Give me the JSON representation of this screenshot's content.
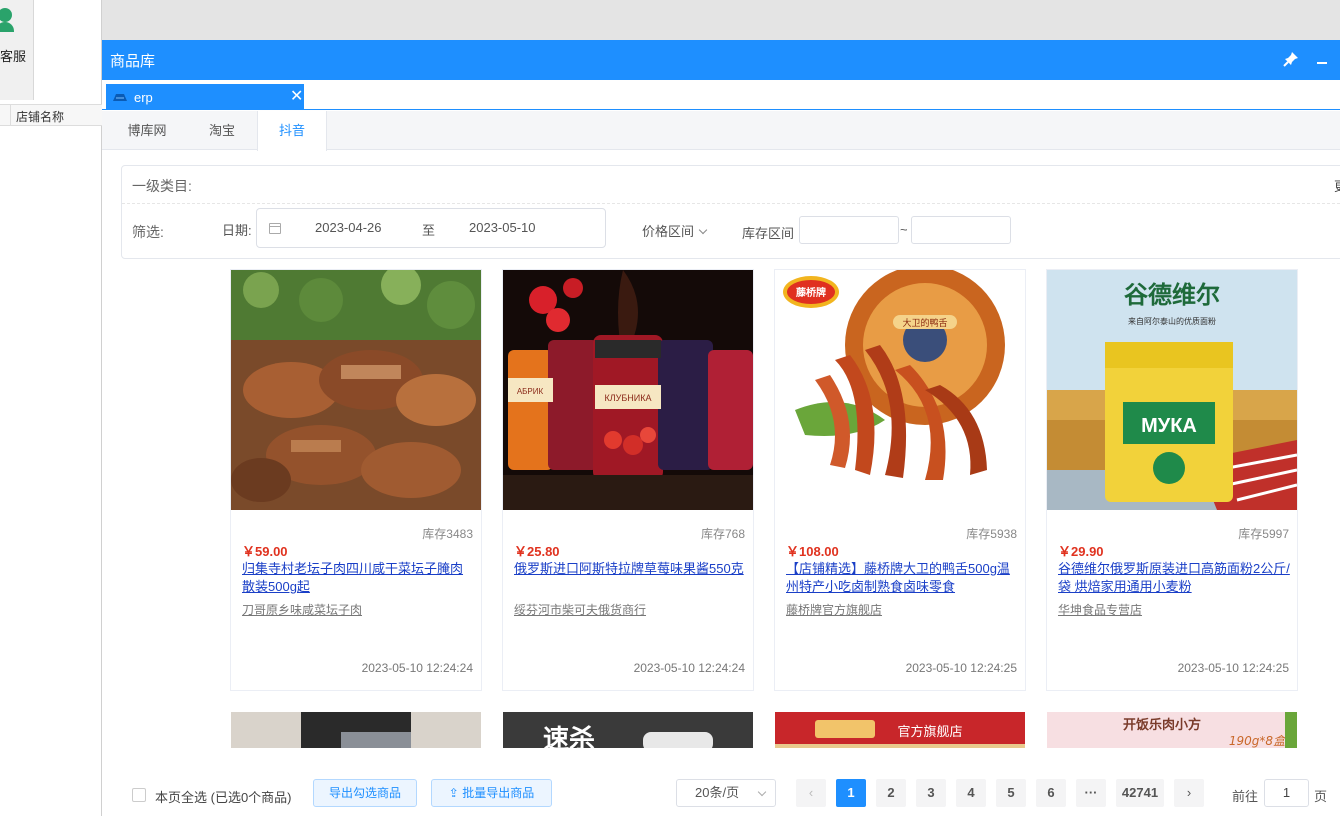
{
  "background": {
    "customer_service_label": "客服",
    "column_shop_name": "店铺名称"
  },
  "window": {
    "title": "商品库",
    "doc_tab_label": "erp",
    "doc_tab_close": "✕"
  },
  "source_tabs": [
    {
      "label": "博库网",
      "active": false
    },
    {
      "label": "淘宝",
      "active": false
    },
    {
      "label": "抖音",
      "active": true
    }
  ],
  "filter": {
    "category_label": "一级类目:",
    "more_label": "更",
    "filter_label": "筛选:",
    "date_label": "日期:",
    "date_start": "2023-04-26",
    "date_to": "至",
    "date_end": "2023-05-10",
    "price_range_label": "价格区间",
    "stock_range_label": "库存区间",
    "stock_min": "",
    "stock_max": "",
    "stock_separator": "~"
  },
  "products": [
    {
      "stock": "库存3483",
      "price": "￥59.00",
      "title": "归集寺村老坛子肉四川咸干菜坛子腌肉散装500g起",
      "shop": "刀哥原乡味咸菜坛子肉",
      "time": "2023-05-10 12:24:24"
    },
    {
      "stock": "库存768",
      "price": "￥25.80",
      "title": "俄罗斯进口阿斯特拉牌草莓味果酱550克",
      "shop": "绥芬河市柴可夫俄货商行",
      "time": "2023-05-10 12:24:24"
    },
    {
      "stock": "库存5938",
      "price": "￥108.00",
      "title": "【店铺精选】藤桥牌大卫的鸭舌500g温州特产小吃卤制熟食卤味零食",
      "shop": "藤桥牌官方旗舰店",
      "time": "2023-05-10 12:24:25"
    },
    {
      "stock": "库存5997",
      "price": "￥29.90",
      "title": "谷德维尔俄罗斯原装进口高筋面粉2公斤/袋 烘焙家用通用小麦粉",
      "shop": "华坤食品专营店",
      "time": "2023-05-10 12:24:25"
    }
  ],
  "image_texts": {
    "jam_brand": "АБРИК",
    "jam_label": "КЛУБНИКА",
    "duck_brand": "藤桥牌",
    "duck_plate": "大卫的鸭舌",
    "flour_brand": "谷德维尔",
    "flour_sub": "来自阿尔泰山的优质面粉",
    "flour_bag": "МУКА",
    "row2_text_2": "速杀",
    "row2_text_3": "官方旗舰店",
    "row2_text_4a": "开饭乐肉小方",
    "row2_text_4b": "190g*8盒"
  },
  "footer": {
    "select_all_label": "本页全选 (已选0个商品)",
    "export_selected_label": "导出勾选商品",
    "batch_export_label": "批量导出商品",
    "page_size": "20条/页",
    "pages": [
      "1",
      "2",
      "3",
      "4",
      "5",
      "6",
      "···",
      "42741"
    ],
    "current_page": "1",
    "prev": "‹",
    "next": "›",
    "goto_label": "前往",
    "goto_value": "1",
    "page_suffix": "页"
  },
  "colors": {
    "primary": "#1e8fff",
    "price": "#e0321f",
    "link": "#1a3fc7"
  }
}
